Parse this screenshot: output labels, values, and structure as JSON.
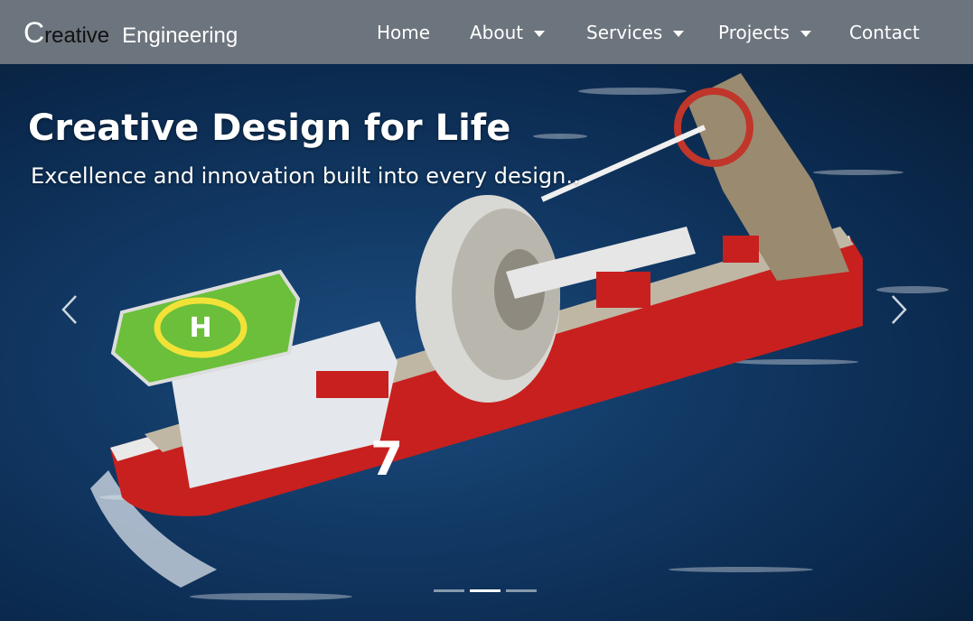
{
  "navbar": {
    "brand": {
      "initial": "C",
      "word1": "reative",
      "word2": "Engineering"
    },
    "items": [
      {
        "label": "Home",
        "dropdown": false
      },
      {
        "label": "About",
        "dropdown": true
      },
      {
        "label": "Services",
        "dropdown": true
      },
      {
        "label": "Projects",
        "dropdown": true
      },
      {
        "label": "Contact",
        "dropdown": false
      }
    ]
  },
  "hero": {
    "title": "Creative Design for Life",
    "subtitle": "Excellence and innovation built into every design..",
    "image": "offshore-vessel-photo",
    "controls": {
      "prev_icon": "chevron-left-icon",
      "next_icon": "chevron-right-icon"
    },
    "indicators": {
      "count": 3,
      "active_index": 1
    }
  },
  "colors": {
    "navbar_bg": "#6c747d",
    "ship_hull": "#c8201e",
    "helideck": "#6bbf3a",
    "sea": "#123a66"
  }
}
